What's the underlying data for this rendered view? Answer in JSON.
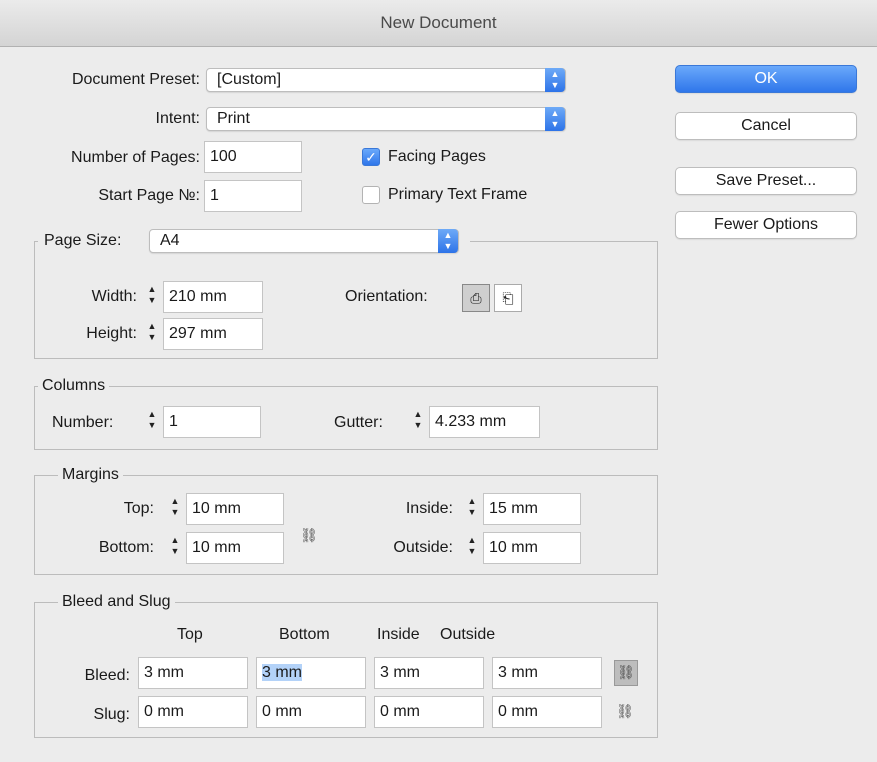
{
  "window": {
    "title": "New Document"
  },
  "preset": {
    "label": "Document Preset:",
    "value": "[Custom]"
  },
  "intent": {
    "label": "Intent:",
    "value": "Print"
  },
  "pages": {
    "label": "Number of Pages:",
    "value": "100"
  },
  "start_page": {
    "label": "Start Page №:",
    "value": "1"
  },
  "facing_pages": {
    "label": "Facing Pages",
    "checked": true
  },
  "primary_text_frame": {
    "label": "Primary Text Frame",
    "checked": false
  },
  "page_size": {
    "label": "Page Size:",
    "value": "A4",
    "width_label": "Width:",
    "width": "210 mm",
    "height_label": "Height:",
    "height": "297 mm",
    "orientation_label": "Orientation:",
    "orientation": "portrait"
  },
  "columns": {
    "legend": "Columns",
    "number_label": "Number:",
    "number": "1",
    "gutter_label": "Gutter:",
    "gutter": "4.233 mm"
  },
  "margins": {
    "legend": "Margins",
    "top_label": "Top:",
    "top": "10 mm",
    "bottom_label": "Bottom:",
    "bottom": "10 mm",
    "inside_label": "Inside:",
    "inside": "15 mm",
    "outside_label": "Outside:",
    "outside": "10 mm"
  },
  "bleed_slug": {
    "legend": "Bleed and Slug",
    "headers": [
      "Top",
      "Bottom",
      "Inside",
      "Outside"
    ],
    "bleed_label": "Bleed:",
    "bleed": [
      "3 mm",
      "3 mm",
      "3 mm",
      "3 mm"
    ],
    "slug_label": "Slug:",
    "slug": [
      "0 mm",
      "0 mm",
      "0 mm",
      "0 mm"
    ]
  },
  "buttons": {
    "ok": "OK",
    "cancel": "Cancel",
    "save_preset": "Save Preset...",
    "fewer_options": "Fewer Options"
  },
  "colors": {
    "accent": "#2f76ea",
    "selection": "#b3d2f8",
    "background": "#ececec"
  }
}
